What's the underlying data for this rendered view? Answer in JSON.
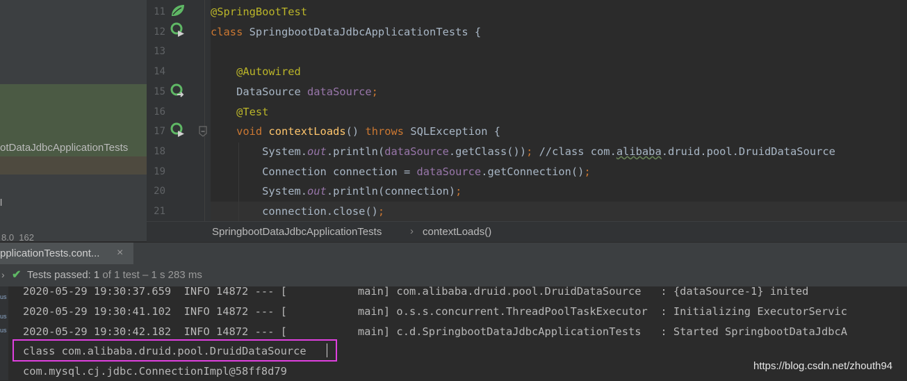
{
  "left_panel": {
    "tree_label": "otDataJdbcApplicationTests",
    "small_label": "l",
    "jdk_version": "8.0_162"
  },
  "editor": {
    "lines": [
      {
        "num": "11",
        "tokens": [
          {
            "t": "@SpringBootTest",
            "c": "ann"
          }
        ]
      },
      {
        "num": "12",
        "tokens": [
          {
            "t": "class ",
            "c": "kw"
          },
          {
            "t": "SpringbootDataJdbcApplicationTests {",
            "c": ""
          }
        ]
      },
      {
        "num": "13",
        "tokens": []
      },
      {
        "num": "14",
        "tokens": [
          {
            "t": "    "
          },
          {
            "t": "@Autowired",
            "c": "ann"
          }
        ]
      },
      {
        "num": "15",
        "tokens": [
          {
            "t": "    DataSource "
          },
          {
            "t": "dataSource",
            "c": "fld"
          },
          {
            "t": ";",
            "c": "kw"
          }
        ]
      },
      {
        "num": "16",
        "tokens": [
          {
            "t": "    "
          },
          {
            "t": "@Test",
            "c": "ann"
          }
        ]
      },
      {
        "num": "17",
        "tokens": [
          {
            "t": "    "
          },
          {
            "t": "void ",
            "c": "kw"
          },
          {
            "t": "contextLoads",
            "c": "mth"
          },
          {
            "t": "() "
          },
          {
            "t": "throws ",
            "c": "kw"
          },
          {
            "t": "SQLException {"
          }
        ]
      },
      {
        "num": "18",
        "tokens": [
          {
            "t": "        System."
          },
          {
            "t": "out",
            "c": "ital"
          },
          {
            "t": ".println("
          },
          {
            "t": "dataSource",
            "c": "fld"
          },
          {
            "t": ".getClass())"
          },
          {
            "t": "; ",
            "c": "kw"
          },
          {
            "t": "//class com."
          },
          {
            "t": "alibaba",
            "c": "typo"
          },
          {
            "t": ".druid.pool.DruidDataSource"
          }
        ]
      },
      {
        "num": "19",
        "tokens": [
          {
            "t": "        Connection connection = "
          },
          {
            "t": "dataSource",
            "c": "fld"
          },
          {
            "t": ".getConnection()"
          },
          {
            "t": ";",
            "c": "kw"
          }
        ]
      },
      {
        "num": "20",
        "tokens": [
          {
            "t": "        System."
          },
          {
            "t": "out",
            "c": "ital"
          },
          {
            "t": ".println(connection)"
          },
          {
            "t": ";",
            "c": "kw"
          }
        ]
      },
      {
        "num": "21",
        "tokens": [
          {
            "t": "        connection.close()"
          },
          {
            "t": ";",
            "c": "kw"
          }
        ]
      }
    ]
  },
  "breadcrumb": {
    "class_name": "SpringbootDataJdbcApplicationTests",
    "separator": "›",
    "method_name": "contextLoads()"
  },
  "run_panel": {
    "tab_label": "pplicationTests.cont...",
    "tab_close": "×",
    "status_arrow": "›",
    "status_check": "✔",
    "status_prefix": "Tests passed: ",
    "status_count": "1",
    "status_suffix": " of 1 test",
    "status_time": " – 1 s 283 ms"
  },
  "console": {
    "lines": [
      "2020-05-29 19:30:37.659  INFO 14872 --- [           main] com.alibaba.druid.pool.DruidDataSource   : {dataSource-1} inited",
      "2020-05-29 19:30:41.102  INFO 14872 --- [           main] o.s.s.concurrent.ThreadPoolTaskExecutor  : Initializing ExecutorServic",
      "2020-05-29 19:30:42.182  INFO 14872 --- [           main] c.d.SpringbootDataJdbcApplicationTests   : Started SpringbootDataJdbcA",
      "class com.alibaba.druid.pool.DruidDataSource",
      "com.mysql.cj.jdbc.ConnectionImpl@58ff8d79"
    ],
    "strip_marks": [
      "us",
      "us",
      "us"
    ],
    "highlight_color": "#e040e0"
  },
  "watermark": "https://blog.csdn.net/zhouth94"
}
